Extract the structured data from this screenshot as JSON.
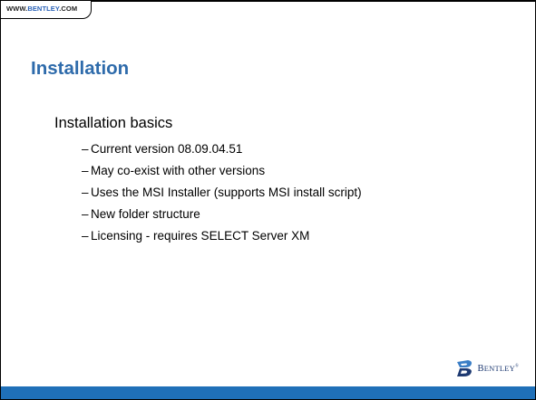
{
  "header": {
    "url_prefix": "WWW.",
    "url_brand": "BENTLEY",
    "url_suffix": ".COM"
  },
  "slide": {
    "title": "Installation",
    "lead": "Installation basics",
    "bullets": [
      "Current version 08.09.04.51",
      "May co-exist with other versions",
      "Uses the MSI Installer (supports MSI install script)",
      "New folder structure",
      "Licensing - requires SELECT Server XM"
    ]
  },
  "logo": {
    "icon": "bentley-logo-icon",
    "text_initial": "B",
    "text_rest": "ENTLEY",
    "trademark": "®"
  },
  "colors": {
    "title": "#2e6bab",
    "bottom_bar": "#1f70b8",
    "logo": "#1e3a72",
    "logo_accent": "#3a7ec6"
  }
}
